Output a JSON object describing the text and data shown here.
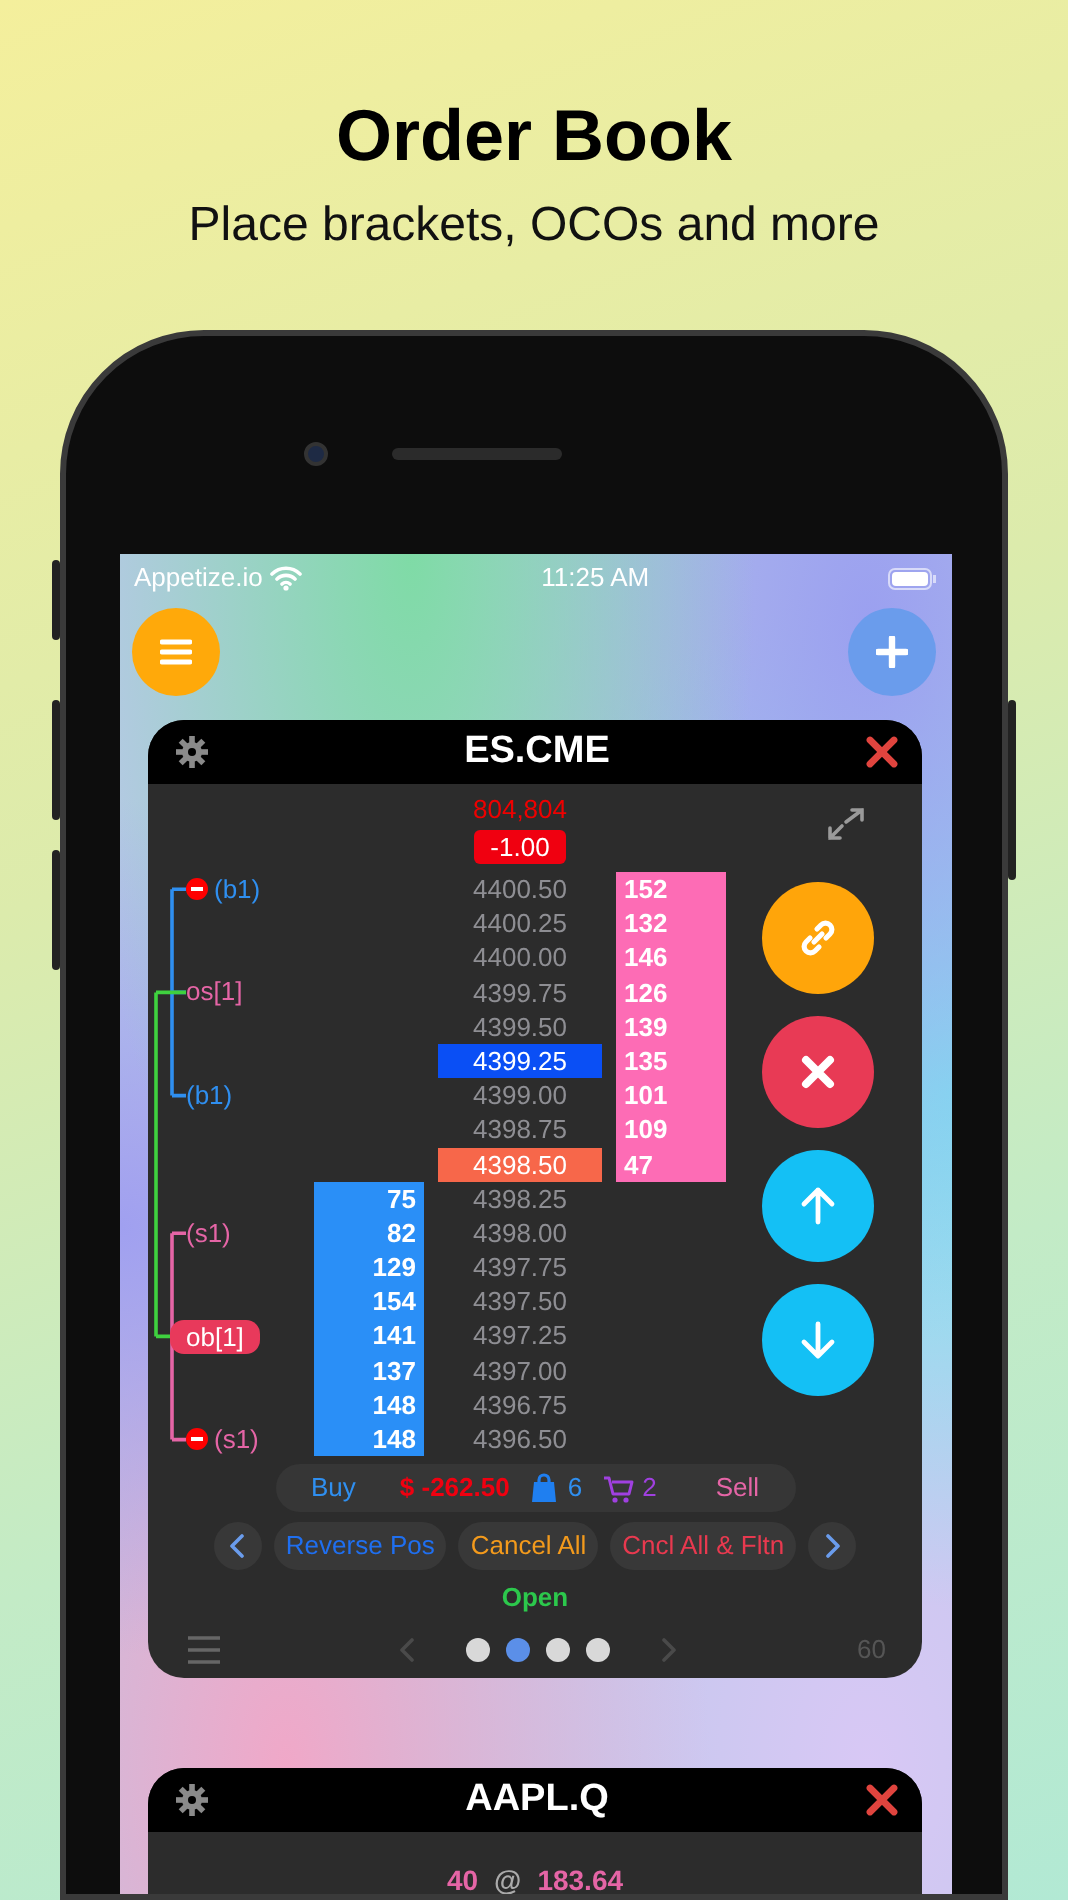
{
  "promo": {
    "title": "Order Book",
    "subtitle": "Place brackets, OCOs and more"
  },
  "status_bar": {
    "carrier": "Appetize.io",
    "time": "11:25 AM"
  },
  "order_book": {
    "symbol": "ES.CME",
    "volume": "804,804",
    "change": "-1.00",
    "oco_line": {
      "color": "#3fd13f"
    },
    "rows": [
      {
        "price": "4400.50",
        "ask": "152",
        "kind": "plain",
        "order": {
          "label": "(b1)",
          "color": "#2f8ff0",
          "kind": "tag",
          "cancel": true,
          "oco": false,
          "bracket": {
            "color": "#2f8ff0"
          }
        }
      },
      {
        "price": "4400.25",
        "ask": "132",
        "kind": "plain"
      },
      {
        "price": "4400.00",
        "ask": "146",
        "kind": "plain"
      },
      {
        "price": "4399.75",
        "ask": "126",
        "kind": "plain",
        "order": {
          "label": "os[1]",
          "color": "#e565a6",
          "kind": "tag",
          "cancel": false,
          "oco": true,
          "bracket": {
            "color": "#2f8ff0"
          }
        }
      },
      {
        "price": "4399.50",
        "ask": "139",
        "kind": "plain"
      },
      {
        "price": "4399.25",
        "ask": "135",
        "kind": "current"
      },
      {
        "price": "4399.00",
        "ask": "101",
        "kind": "plain",
        "order": {
          "label": "(b1)",
          "color": "#2f8ff0",
          "kind": "tag",
          "cancel": false,
          "oco": false,
          "bracket": {
            "color": "#2f8ff0"
          }
        }
      },
      {
        "price": "4398.75",
        "ask": "109",
        "kind": "plain"
      },
      {
        "price": "4398.50",
        "ask": "47",
        "kind": "last"
      },
      {
        "price": "4398.25",
        "bid": "75",
        "kind": "plain"
      },
      {
        "price": "4398.00",
        "bid": "82",
        "kind": "plain",
        "order": {
          "label": "(s1)",
          "color": "#e565a6",
          "kind": "tag",
          "cancel": false,
          "oco": false,
          "bracket": {
            "color": "#e565a6"
          }
        }
      },
      {
        "price": "4397.75",
        "bid": "129",
        "kind": "plain"
      },
      {
        "price": "4397.50",
        "bid": "154",
        "kind": "plain"
      },
      {
        "price": "4397.25",
        "bid": "141",
        "kind": "plain",
        "order": {
          "label": "ob[1]",
          "color": "#e8395b",
          "kind": "pill",
          "cancel": false,
          "oco": true,
          "bracket": {
            "color": "#e565a6"
          }
        }
      },
      {
        "price": "4397.00",
        "bid": "137",
        "kind": "plain"
      },
      {
        "price": "4396.75",
        "bid": "148",
        "kind": "plain"
      },
      {
        "price": "4396.50",
        "bid": "148",
        "kind": "plain",
        "order": {
          "label": "(s1)",
          "color": "#e565a6",
          "kind": "tag",
          "cancel": true,
          "oco": false,
          "bracket": {
            "color": "#e565a6"
          }
        }
      }
    ],
    "side_buttons": [
      {
        "kind": "link"
      },
      {
        "kind": "cancel"
      },
      {
        "kind": "up"
      },
      {
        "kind": "down"
      }
    ],
    "summary": {
      "buy": "Buy",
      "pnl": "$ -262.50",
      "positions": "6",
      "orders": "2",
      "sell": "Sell"
    },
    "actions": [
      {
        "label": "Reverse Pos",
        "color": "#1f6ff0"
      },
      {
        "label": "Cancel All",
        "color": "#f39a1c"
      },
      {
        "label": "Cncl All & Fltn",
        "color": "#e8394f"
      }
    ],
    "status": "Open",
    "pages": [
      {
        "selected": false
      },
      {
        "selected": true
      },
      {
        "selected": false
      },
      {
        "selected": false
      }
    ],
    "interval": "60"
  },
  "next_card": {
    "symbol": "AAPL.Q",
    "quantity": "40",
    "at": "@",
    "price": "183.64"
  }
}
